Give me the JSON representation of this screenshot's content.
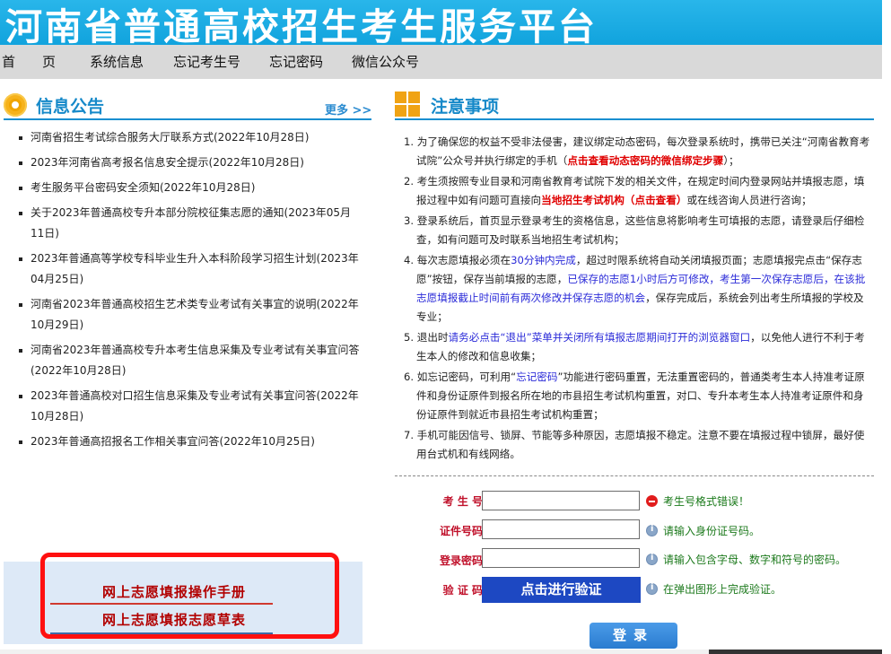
{
  "banner": {
    "title": "河南省普通高校招生考生服务平台"
  },
  "nav": {
    "items": [
      {
        "label": "首　　页"
      },
      {
        "label": "系统信息"
      },
      {
        "label": "忘记考生号"
      },
      {
        "label": "忘记密码"
      },
      {
        "label": "微信公众号"
      }
    ]
  },
  "notices": {
    "title": "信息公告",
    "more": "更多 >>",
    "items": [
      {
        "text": "河南省招生考试综合服务大厅联系方式(2022年10月28日)"
      },
      {
        "text": "2023年河南省高考报名信息安全提示(2022年10月28日)"
      },
      {
        "text": "考生服务平台密码安全须知(2022年10月28日)"
      },
      {
        "text": "关于2023年普通高校专升本部分院校征集志愿的通知(2023年05月11日)"
      },
      {
        "text": "2023年普通高等学校专科毕业生升入本科阶段学习招生计划(2023年04月25日)"
      },
      {
        "text": "河南省2023年普通高校招生艺术类专业考试有关事宜的说明(2022年10月29日)"
      },
      {
        "text": "河南省2023年普通高校专升本考生信息采集及专业考试有关事宜问答(2022年10月28日)"
      },
      {
        "text": "2023年普通高校对口招生信息采集及专业考试有关事宜问答(2022年10月28日)"
      },
      {
        "text": "2023年普通高招报名工作相关事宜问答(2022年10月25日)"
      }
    ]
  },
  "manual": {
    "link1": "网上志愿填报操作手册",
    "link2": "网上志愿填报志愿草表"
  },
  "cautions": {
    "title": "注意事项",
    "items": {
      "i1a": "1. 为了确保您的权益不受非法侵害，建议绑定动态密码，每次登录系统时，携带已关注“河南省教育考试院”公众号并执行绑定的手机（",
      "i1b": "点击查看动态密码的微信绑定步骤",
      "i1c": "）；",
      "i2a": "2. 考生须按照专业目录和河南省教育考试院下发的相关文件，在规定时间内登录网站并填报志愿，填报过程中如有问题可直接向",
      "i2b": "当地招生考试机构（点击查看）",
      "i2c": "或在线咨询人员进行咨询；",
      "i3": "3. 登录系统后，首页显示登录考生的资格信息，这些信息将影响考生可填报的志愿，请登录后仔细检查，如有问题可及时联系当地招生考试机构；",
      "i4a": "4. 每次志愿填报必须在",
      "i4b": "30分钟内完成",
      "i4c": "，超过时限系统将自动关闭填报页面；志愿填报完点击“保存志愿”按钮，保存当前填报的志愿，",
      "i4d": "已保存的志愿1小时后方可修改，考生第一次保存志愿后，在该批志愿填报截止时间前有两次修改并保存志愿的机会",
      "i4e": "，保存完成后，系统会列出考生所填报的学校及专业；",
      "i5a": "5. 退出时",
      "i5b": "请务必点击“退出”菜单并关闭所有填报志愿期间打开的浏览器窗口",
      "i5c": "，以免他人进行不利于考生本人的修改和信息收集；",
      "i6a": "6. 如忘记密码，可利用“",
      "i6b": "忘记密码",
      "i6c": "”功能进行密码重置，无法重置密码的，普通类考生本人持准考证原件和身份证原件到报名所在地的市县招生考试机构重置，对口、专升本考生本人持准考证原件和身份证原件到就近市县招生考试机构重置；",
      "i7": "7. 手机可能因信号、锁屏、节能等多种原因，志愿填报不稳定。注意不要在填报过程中锁屏，最好使用台式机和有线网络。"
    }
  },
  "form": {
    "exam_label": "考 生 号：",
    "exam_value": "",
    "exam_hint": "考生号格式错误！",
    "id_label": "证件号码：",
    "id_value": "",
    "id_hint": "请输入身份证号码。",
    "pwd_label": "登录密码：",
    "pwd_value": "",
    "pwd_hint": "请输入包含字母、数字和符号的密码。",
    "captcha_label": "验 证 码：",
    "captcha_button": "点击进行验证",
    "captcha_hint": "在弹出图形上完成验证。",
    "login_button": "登录"
  },
  "colors": {
    "banner": "#1ba9e1",
    "accent_blue": "#1689c9",
    "warning_red": "#e00000",
    "manual_red": "#b20000",
    "highlight_border": "#ff1010",
    "verify_blue": "#1d48c2"
  }
}
